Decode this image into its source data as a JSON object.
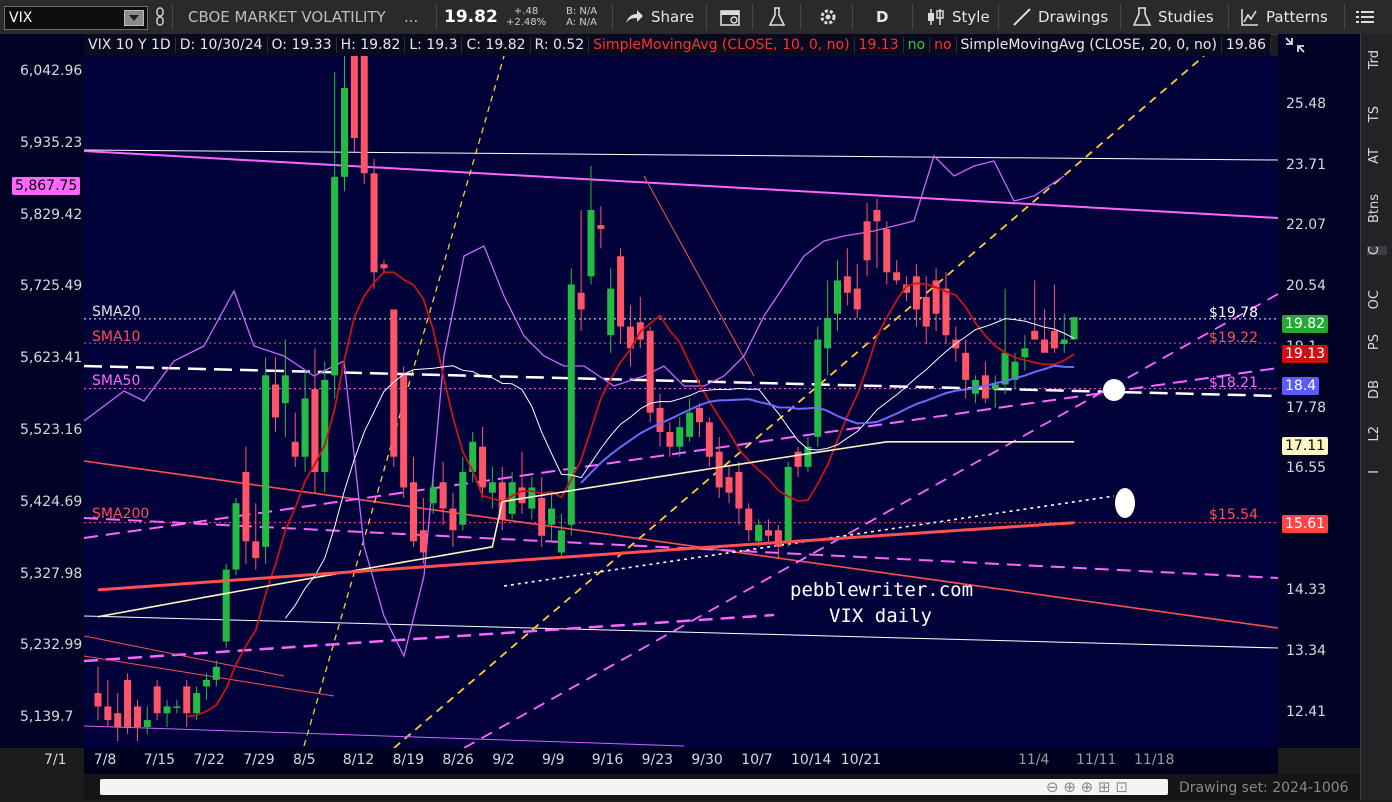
{
  "toolbar": {
    "symbol": "VIX",
    "description": "CBOE MARKET VOLATILITY",
    "ellipsis": "...",
    "last": "19.82",
    "change_abs": "+.48",
    "change_pct": "+2.48%",
    "bid": "B: N/A",
    "ask": "A: N/A",
    "share": "Share",
    "aggregation": "D",
    "style": "Style",
    "drawings": "Drawings",
    "studies": "Studies",
    "patterns": "Patterns"
  },
  "header": {
    "title": "VIX 10 Y 1D",
    "date": "D: 10/30/24",
    "open": "O: 19.33",
    "high": "H: 19.82",
    "low": "L: 19.3",
    "close": "C: 19.82",
    "range": "R: 0.52",
    "sma10_label": "SimpleMovingAvg (CLOSE, 10, 0, no)",
    "sma10_value": "19.13",
    "flag_no1": "no",
    "flag_no2": "no",
    "sma20_label": "SimpleMovingAvg (CLOSE, 20, 0, no)",
    "sma20_value": "19.86"
  },
  "sidebar": [
    "Trd",
    "TS",
    "AT",
    "Btns",
    "C",
    "OC",
    "PS",
    "DB",
    "L2",
    "I"
  ],
  "colors": {
    "background": "#02023a",
    "up": "#22bb44",
    "down": "#ff5566",
    "sma10": "#c81414",
    "sma20": "#ffffff",
    "sma50": "#6a6aff",
    "sma200": "#ff5050",
    "magenta": "#ff66ff",
    "yellow_dashed": "#ffcc33",
    "spx": "#cc66ff"
  },
  "chart_data": {
    "type": "candlestick",
    "y_left": {
      "ticks": [
        "6,042.96",
        "5,935.23",
        "5,829.42",
        "5,725.49",
        "5,623.41",
        "5,523.16",
        "5,424.69",
        "5,327.98",
        "5,232.99",
        "5,139.7"
      ],
      "highlight": "5,867.75"
    },
    "y_right": {
      "ticks": [
        "25.48",
        "23.71",
        "22.07",
        "20.54",
        "19.1",
        "17.78",
        "16.55",
        "15.4",
        "14.33",
        "13.34",
        "12.41"
      ],
      "range": [
        11.9,
        27.0
      ],
      "log": true
    },
    "x_labels": [
      "7/1",
      "7/8",
      "7/15",
      "7/22",
      "7/29",
      "8/5",
      "8/12",
      "8/19",
      "8/26",
      "9/2",
      "9/9",
      "9/16",
      "9/23",
      "9/30",
      "10/7",
      "10/14",
      "10/21",
      "11/4",
      "11/11",
      "11/18"
    ],
    "overlay_labels": {
      "sma20": "SMA20",
      "sma10": "SMA10",
      "sma50": "SMA50",
      "sma200": "SMA200",
      "p1978": "$19.78",
      "p1922": "$19.22",
      "p1821": "$18.21",
      "p1554": "$15.54"
    },
    "price_tags": [
      "19.82",
      "19.13",
      "18.4",
      "17.11",
      "15.61"
    ],
    "annotation_line1": "pebblewriter.com",
    "annotation_line2": "VIX daily",
    "drawing_set": "Drawing set: 2024-1006",
    "candles": [
      {
        "o": 12.7,
        "h": 13.1,
        "l": 12.3,
        "c": 12.5
      },
      {
        "o": 12.5,
        "h": 12.9,
        "l": 12.2,
        "c": 12.3
      },
      {
        "o": 12.4,
        "h": 12.7,
        "l": 12.0,
        "c": 12.2
      },
      {
        "o": 12.9,
        "h": 13.0,
        "l": 12.1,
        "c": 12.2
      },
      {
        "o": 12.5,
        "h": 12.6,
        "l": 12.0,
        "c": 12.2
      },
      {
        "o": 12.2,
        "h": 12.5,
        "l": 12.1,
        "c": 12.3
      },
      {
        "o": 12.8,
        "h": 12.9,
        "l": 12.3,
        "c": 12.4
      },
      {
        "o": 12.4,
        "h": 12.6,
        "l": 12.2,
        "c": 12.5
      },
      {
        "o": 12.5,
        "h": 12.6,
        "l": 12.4,
        "c": 12.5
      },
      {
        "o": 12.8,
        "h": 12.9,
        "l": 12.2,
        "c": 12.4
      },
      {
        "o": 12.4,
        "h": 12.8,
        "l": 12.3,
        "c": 12.7
      },
      {
        "o": 12.8,
        "h": 13.0,
        "l": 12.6,
        "c": 12.9
      },
      {
        "o": 12.9,
        "h": 13.2,
        "l": 12.8,
        "c": 13.1
      },
      {
        "o": 13.5,
        "h": 14.8,
        "l": 13.4,
        "c": 14.7
      },
      {
        "o": 14.7,
        "h": 16.0,
        "l": 14.6,
        "c": 15.9
      },
      {
        "o": 16.5,
        "h": 17.0,
        "l": 14.8,
        "c": 15.2
      },
      {
        "o": 15.2,
        "h": 15.9,
        "l": 14.7,
        "c": 14.9
      },
      {
        "o": 15.1,
        "h": 18.9,
        "l": 14.8,
        "c": 18.5
      },
      {
        "o": 18.3,
        "h": 18.9,
        "l": 17.3,
        "c": 17.6
      },
      {
        "o": 17.9,
        "h": 19.3,
        "l": 17.2,
        "c": 18.5
      },
      {
        "o": 17.1,
        "h": 17.7,
        "l": 16.6,
        "c": 16.8
      },
      {
        "o": 16.8,
        "h": 18.6,
        "l": 16.5,
        "c": 18.0
      },
      {
        "o": 18.2,
        "h": 19.1,
        "l": 16.1,
        "c": 16.5
      },
      {
        "o": 16.5,
        "h": 18.8,
        "l": 16.1,
        "c": 18.4
      },
      {
        "o": 18.5,
        "h": 26.5,
        "l": 18.0,
        "c": 23.4
      },
      {
        "o": 23.4,
        "h": 27.0,
        "l": 23.0,
        "c": 26.0
      },
      {
        "o": 27.0,
        "h": 27.0,
        "l": 24.1,
        "c": 24.5
      },
      {
        "o": 27.0,
        "h": 27.0,
        "l": 23.2,
        "c": 23.5
      },
      {
        "o": 23.5,
        "h": 23.9,
        "l": 20.5,
        "c": 20.9
      },
      {
        "o": 21.1,
        "h": 21.2,
        "l": 20.9,
        "c": 21.0
      },
      {
        "o": 20.0,
        "h": 20.0,
        "l": 16.6,
        "c": 16.8
      },
      {
        "o": 18.5,
        "h": 18.7,
        "l": 16.0,
        "c": 16.2
      },
      {
        "o": 16.3,
        "h": 16.8,
        "l": 15.1,
        "c": 15.2
      },
      {
        "o": 15.4,
        "h": 16.0,
        "l": 14.8,
        "c": 15.0
      },
      {
        "o": 15.9,
        "h": 16.4,
        "l": 15.7,
        "c": 16.2
      },
      {
        "o": 16.3,
        "h": 16.7,
        "l": 15.5,
        "c": 15.8
      },
      {
        "o": 15.8,
        "h": 16.1,
        "l": 15.1,
        "c": 15.4
      },
      {
        "o": 15.5,
        "h": 16.8,
        "l": 15.4,
        "c": 16.5
      },
      {
        "o": 16.5,
        "h": 17.3,
        "l": 16.3,
        "c": 17.1
      },
      {
        "o": 17.0,
        "h": 17.4,
        "l": 16.0,
        "c": 16.2
      },
      {
        "o": 16.1,
        "h": 16.6,
        "l": 15.8,
        "c": 16.3
      },
      {
        "o": 16.3,
        "h": 16.6,
        "l": 15.4,
        "c": 15.6
      },
      {
        "o": 15.7,
        "h": 16.5,
        "l": 15.6,
        "c": 16.3
      },
      {
        "o": 16.2,
        "h": 16.9,
        "l": 15.7,
        "c": 15.9
      },
      {
        "o": 15.8,
        "h": 16.4,
        "l": 15.6,
        "c": 16.2
      },
      {
        "o": 16.0,
        "h": 16.4,
        "l": 15.1,
        "c": 15.3
      },
      {
        "o": 15.5,
        "h": 16.1,
        "l": 15.2,
        "c": 15.8
      },
      {
        "o": 15.0,
        "h": 15.7,
        "l": 14.9,
        "c": 15.4
      },
      {
        "o": 15.5,
        "h": 21.0,
        "l": 15.3,
        "c": 20.6
      },
      {
        "o": 20.4,
        "h": 22.5,
        "l": 19.5,
        "c": 20.0
      },
      {
        "o": 20.8,
        "h": 23.7,
        "l": 20.6,
        "c": 22.5
      },
      {
        "o": 22.1,
        "h": 22.6,
        "l": 21.5,
        "c": 22.0
      },
      {
        "o": 19.4,
        "h": 21.0,
        "l": 19.0,
        "c": 20.5
      },
      {
        "o": 21.3,
        "h": 21.5,
        "l": 19.2,
        "c": 19.6
      },
      {
        "o": 19.6,
        "h": 20.1,
        "l": 18.7,
        "c": 19.1
      },
      {
        "o": 19.7,
        "h": 20.3,
        "l": 19.1,
        "c": 19.3
      },
      {
        "o": 19.5,
        "h": 19.6,
        "l": 17.5,
        "c": 17.7
      },
      {
        "o": 17.8,
        "h": 18.1,
        "l": 17.0,
        "c": 17.3
      },
      {
        "o": 17.3,
        "h": 17.5,
        "l": 16.8,
        "c": 17.0
      },
      {
        "o": 17.0,
        "h": 17.6,
        "l": 16.8,
        "c": 17.4
      },
      {
        "o": 17.2,
        "h": 18.0,
        "l": 17.1,
        "c": 17.7
      },
      {
        "o": 17.8,
        "h": 17.9,
        "l": 17.2,
        "c": 17.5
      },
      {
        "o": 17.5,
        "h": 17.6,
        "l": 16.6,
        "c": 16.8
      },
      {
        "o": 16.9,
        "h": 17.2,
        "l": 16.0,
        "c": 16.2
      },
      {
        "o": 16.4,
        "h": 16.6,
        "l": 15.9,
        "c": 16.1
      },
      {
        "o": 16.5,
        "h": 16.7,
        "l": 15.5,
        "c": 15.8
      },
      {
        "o": 15.8,
        "h": 15.9,
        "l": 15.2,
        "c": 15.4
      },
      {
        "o": 15.2,
        "h": 15.6,
        "l": 15.1,
        "c": 15.5
      },
      {
        "o": 15.4,
        "h": 15.6,
        "l": 15.2,
        "c": 15.3
      },
      {
        "o": 15.4,
        "h": 15.5,
        "l": 14.9,
        "c": 15.1
      },
      {
        "o": 15.2,
        "h": 16.7,
        "l": 15.1,
        "c": 16.6
      },
      {
        "o": 16.9,
        "h": 17.0,
        "l": 16.4,
        "c": 16.6
      },
      {
        "o": 16.6,
        "h": 17.2,
        "l": 16.5,
        "c": 17.0
      },
      {
        "o": 17.2,
        "h": 19.6,
        "l": 17.0,
        "c": 19.3
      },
      {
        "o": 19.1,
        "h": 20.7,
        "l": 18.5,
        "c": 19.8
      },
      {
        "o": 19.9,
        "h": 21.2,
        "l": 19.5,
        "c": 20.7
      },
      {
        "o": 20.8,
        "h": 21.5,
        "l": 20.1,
        "c": 20.4
      },
      {
        "o": 20.5,
        "h": 21.1,
        "l": 19.8,
        "c": 20.0
      },
      {
        "o": 22.2,
        "h": 22.7,
        "l": 20.8,
        "c": 21.2
      },
      {
        "o": 22.5,
        "h": 22.8,
        "l": 21.0,
        "c": 22.2
      },
      {
        "o": 22.0,
        "h": 22.2,
        "l": 20.6,
        "c": 20.9
      },
      {
        "o": 20.9,
        "h": 21.2,
        "l": 20.6,
        "c": 20.7
      },
      {
        "o": 20.6,
        "h": 20.8,
        "l": 20.2,
        "c": 20.4
      },
      {
        "o": 20.8,
        "h": 21.1,
        "l": 19.6,
        "c": 20.0
      },
      {
        "o": 20.3,
        "h": 20.8,
        "l": 19.2,
        "c": 19.6
      },
      {
        "o": 20.7,
        "h": 21.0,
        "l": 19.5,
        "c": 19.9
      },
      {
        "o": 20.5,
        "h": 20.9,
        "l": 19.2,
        "c": 19.4
      },
      {
        "o": 19.3,
        "h": 19.6,
        "l": 18.8,
        "c": 19.1
      },
      {
        "o": 19.0,
        "h": 19.3,
        "l": 18.0,
        "c": 18.4
      },
      {
        "o": 18.1,
        "h": 18.5,
        "l": 17.9,
        "c": 18.4
      },
      {
        "o": 18.5,
        "h": 18.8,
        "l": 17.9,
        "c": 18.0
      },
      {
        "o": 18.2,
        "h": 18.5,
        "l": 17.8,
        "c": 18.3
      },
      {
        "o": 18.3,
        "h": 20.5,
        "l": 18.1,
        "c": 19.0
      },
      {
        "o": 18.4,
        "h": 19.0,
        "l": 18.2,
        "c": 18.8
      },
      {
        "o": 18.9,
        "h": 19.4,
        "l": 18.6,
        "c": 19.1
      },
      {
        "o": 19.5,
        "h": 20.7,
        "l": 19.3,
        "c": 19.3
      },
      {
        "o": 19.3,
        "h": 20.0,
        "l": 19.2,
        "c": 19.0
      },
      {
        "o": 19.5,
        "h": 20.6,
        "l": 19.0,
        "c": 19.1
      },
      {
        "o": 19.2,
        "h": 19.9,
        "l": 19.0,
        "c": 19.3
      },
      {
        "o": 19.3,
        "h": 19.8,
        "l": 19.3,
        "c": 19.82
      }
    ]
  }
}
